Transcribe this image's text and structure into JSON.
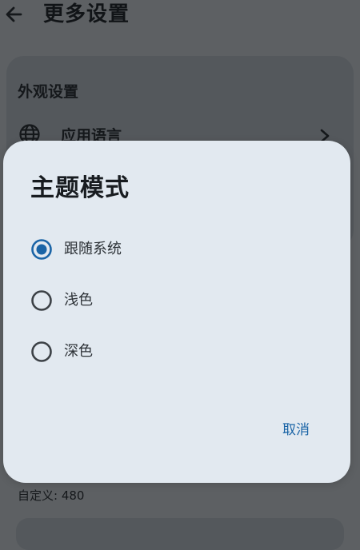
{
  "app_bar": {
    "back_icon": "arrow-left-icon",
    "title": "更多设置"
  },
  "settings": {
    "section_header": "外观设置",
    "app_language": {
      "icon": "globe-icon",
      "label": "应用语言",
      "trailing_icon": "chevron-right-icon"
    },
    "custom_value": "自定义: 480"
  },
  "dialog": {
    "title": "主题模式",
    "options": [
      {
        "label": "跟随系统",
        "selected": true
      },
      {
        "label": "浅色",
        "selected": false
      },
      {
        "label": "深色",
        "selected": false
      }
    ],
    "cancel_label": "取消"
  },
  "colors": {
    "accent": "#1a64a6",
    "dialog_surface": "#e2e9f0",
    "scrim_background": "#5d6063"
  }
}
